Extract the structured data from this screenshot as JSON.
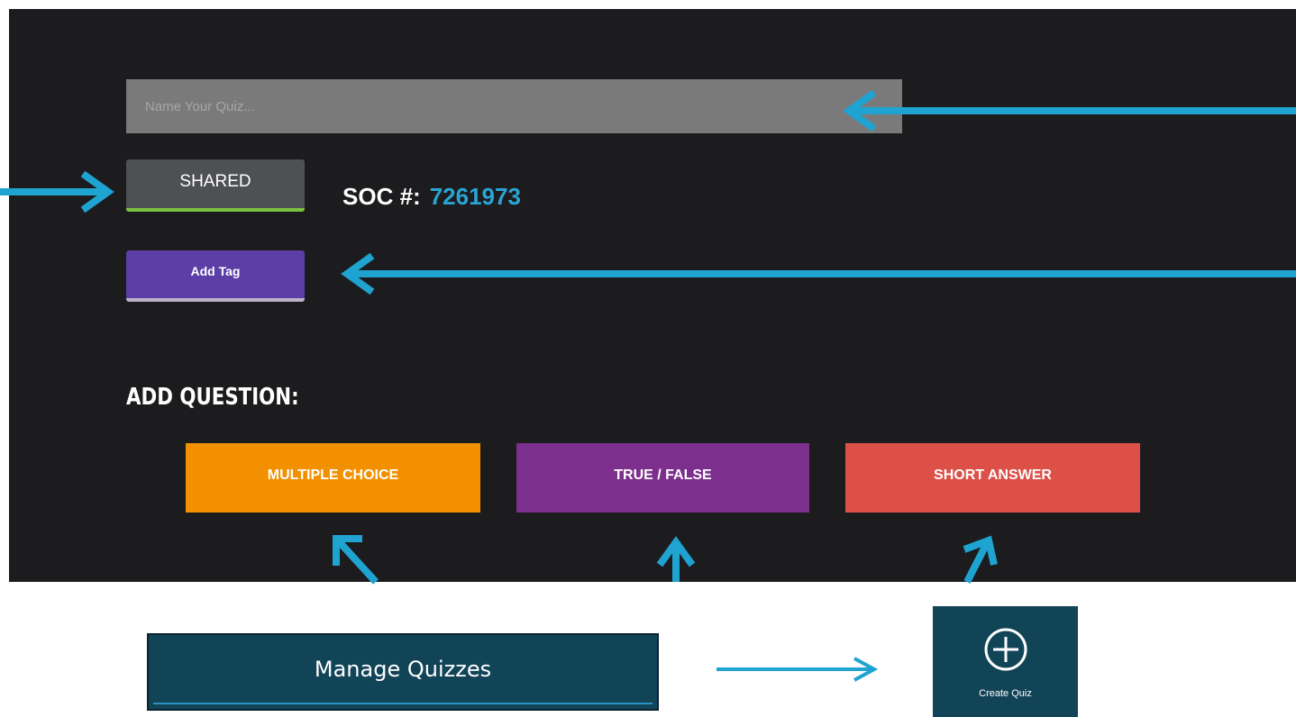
{
  "quiz_name": {
    "placeholder": "Name Your Quiz..."
  },
  "sharing": {
    "button_label": "SHARED"
  },
  "soc": {
    "label": "SOC #:",
    "value": "7261973"
  },
  "tag": {
    "button_label": "Add Tag"
  },
  "add_question": {
    "heading": "ADD QUESTION:",
    "types": [
      {
        "label": "MULTIPLE CHOICE",
        "color": "#f29000"
      },
      {
        "label": "TRUE / FALSE",
        "color": "#7c2f8c"
      },
      {
        "label": "SHORT ANSWER",
        "color": "#dc5048"
      }
    ]
  },
  "bottom": {
    "manage_label": "Manage Quizzes",
    "create_label": "Create Quiz",
    "create_icon": "plus-circle-icon"
  },
  "colors": {
    "panel_bg": "#1c1c1e",
    "annotation_arrow": "#1fa3d1",
    "soc_value": "#2aa4d4",
    "shared_underline": "#7cc242",
    "tag_button": "#5b3ea6",
    "manage_bg": "#124458"
  }
}
